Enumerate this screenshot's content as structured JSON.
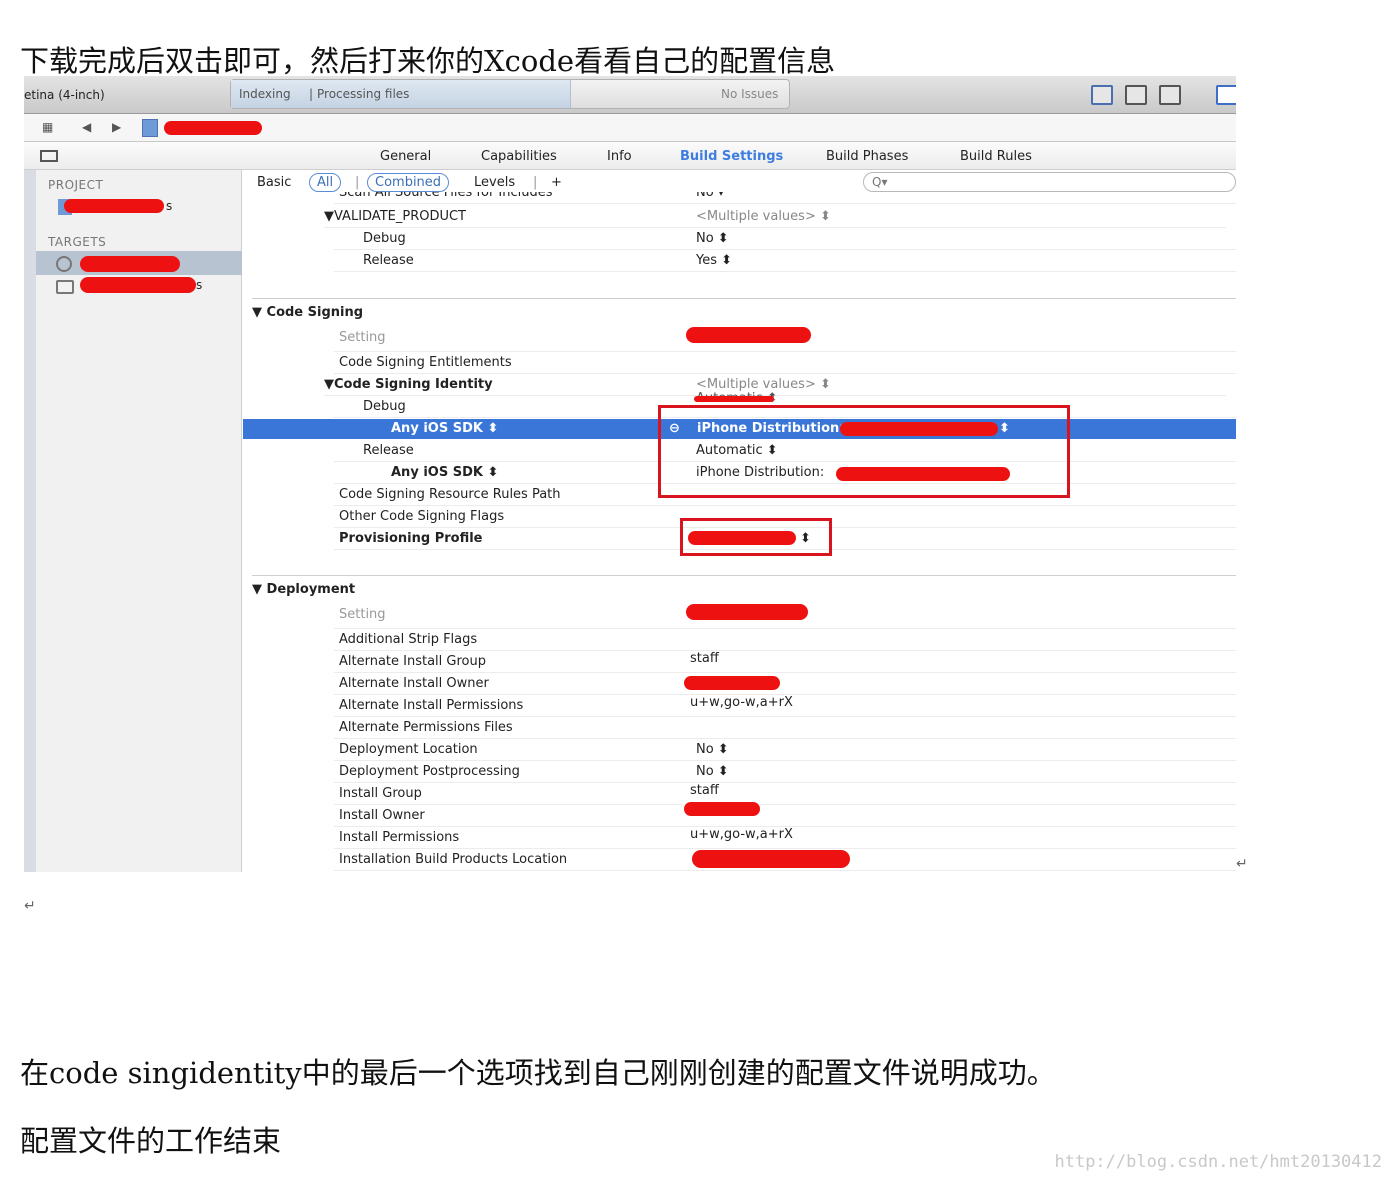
{
  "doc": {
    "heading": "下载完成后双击即可，然后打来你的Xcode看看自己的配置信息",
    "para1": "在code singidentity中的最后一个选项找到自己刚刚创建的配置文件说明成功。",
    "para2": "配置文件的工作结束",
    "return_mark": "↵",
    "watermark": "http://blog.csdn.net/hmt20130412"
  },
  "toolbar": {
    "scheme": "etina (4-inch)",
    "activity_indexing": "Indexing",
    "activity_status": "Processing files",
    "issues": "No Issues"
  },
  "jumpbar": {
    "grid": "▦",
    "back": "◀",
    "forward": "▶"
  },
  "tabs": [
    "General",
    "Capabilities",
    "Info",
    "Build Settings",
    "Build Phases",
    "Build Rules"
  ],
  "sidebar": {
    "project_header": "PROJECT",
    "targets_header": "TARGETS",
    "partial_s": "s",
    "partial_s2": "s"
  },
  "filter": {
    "basic": "Basic",
    "all": "All",
    "combined": "Combined",
    "levels": "Levels",
    "add": "+",
    "search_glyph": "Q▾"
  },
  "validate": {
    "cut_off_key": "Scan All Source Files for Includes",
    "cut_off_value": "No ▾",
    "title": "▼VALIDATE_PRODUCT",
    "value": "<Multiple values> ⬍",
    "debug_label": "Debug",
    "debug_value": "No ⬍",
    "release_label": "Release",
    "release_value": "Yes ⬍"
  },
  "code_signing": {
    "section": "▼ Code Signing",
    "setting_header": "Setting",
    "entitlements": "Code Signing Entitlements",
    "identity": "▼Code Signing Identity",
    "identity_value": "<Multiple values> ⬍",
    "debug_label": "Debug",
    "debug_value": "Automatic ⬍",
    "any_sdk_debug": "Any iOS SDK ⬍",
    "any_sdk_debug_value": "iPhone Distribution:",
    "release_label": "Release",
    "release_value": "Automatic ⬍",
    "any_sdk_release": "Any iOS SDK ⬍",
    "any_sdk_release_value": "iPhone Distribution:",
    "resource_rules": "Code Signing Resource Rules Path",
    "other_flags": "Other Code Signing Flags",
    "provisioning": "Provisioning Profile",
    "provisioning_arrow": "⬍",
    "minus_glyph": "⊖",
    "arrows_glyph": "⬍"
  },
  "deployment": {
    "section": "▼ Deployment",
    "setting_header": "Setting",
    "rows": [
      {
        "key": "Additional Strip Flags",
        "value": ""
      },
      {
        "key": "Alternate Install Group",
        "value": "staff"
      },
      {
        "key": "Alternate Install Owner",
        "value": ""
      },
      {
        "key": "Alternate Install Permissions",
        "value": "u+w,go-w,a+rX"
      },
      {
        "key": "Alternate Permissions Files",
        "value": ""
      },
      {
        "key": "Deployment Location",
        "value": "No ⬍"
      },
      {
        "key": "Deployment Postprocessing",
        "value": "No ⬍"
      },
      {
        "key": "Install Group",
        "value": "staff"
      },
      {
        "key": "Install Owner",
        "value": ""
      },
      {
        "key": "Install Permissions",
        "value": "u+w,go-w,a+rX"
      },
      {
        "key": "Installation Build Products Location",
        "value": ""
      }
    ]
  },
  "colors": {
    "accent": "#3a76d8",
    "redaction": "#ee1111",
    "annotation_box": "#d9141e"
  }
}
